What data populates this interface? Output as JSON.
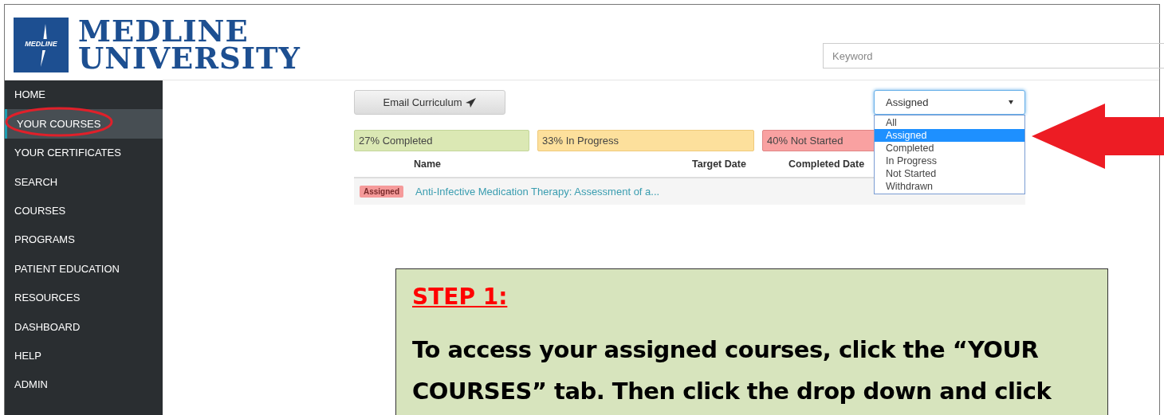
{
  "logo": {
    "mark": "MEDLINE",
    "line_1": "MEDLINE",
    "line_2": "UNIVERSITY"
  },
  "search": {
    "placeholder": "Keyword"
  },
  "sidebar": {
    "items": [
      {
        "label": "HOME",
        "selected": false
      },
      {
        "label": "YOUR COURSES",
        "selected": true
      },
      {
        "label": "YOUR CERTIFICATES",
        "selected": false
      },
      {
        "label": "SEARCH",
        "selected": false
      },
      {
        "label": "COURSES",
        "selected": false
      },
      {
        "label": "PROGRAMS",
        "selected": false
      },
      {
        "label": "PATIENT EDUCATION",
        "selected": false
      },
      {
        "label": "RESOURCES",
        "selected": false
      },
      {
        "label": "DASHBOARD",
        "selected": false
      },
      {
        "label": "HELP",
        "selected": false
      },
      {
        "label": "ADMIN",
        "selected": false
      }
    ]
  },
  "email_button": {
    "label": "Email Curriculum"
  },
  "filter": {
    "value": "Assigned",
    "expanded": true,
    "options": [
      {
        "label": "All",
        "selected": false
      },
      {
        "label": "Assigned",
        "selected": true
      },
      {
        "label": "Completed",
        "selected": false
      },
      {
        "label": "In Progress",
        "selected": false
      },
      {
        "label": "Not Started",
        "selected": false
      },
      {
        "label": "Withdrawn",
        "selected": false
      }
    ]
  },
  "summary": [
    {
      "kind": "completed",
      "label": "27% Completed"
    },
    {
      "kind": "in_progress",
      "label": "33% In Progress"
    },
    {
      "kind": "not_started",
      "label": "40% Not Started"
    }
  ],
  "table": {
    "columns": [
      "Name",
      "Target Date",
      "Completed Date"
    ],
    "rows": [
      {
        "badge": "Assigned",
        "name": "Anti-Infective Medication Therapy: Assessment of a..."
      }
    ]
  },
  "callout": {
    "heading": "STEP 1:",
    "text": "To access your assigned courses, click the “YOUR COURSES” tab. Then click the drop down and click"
  }
}
